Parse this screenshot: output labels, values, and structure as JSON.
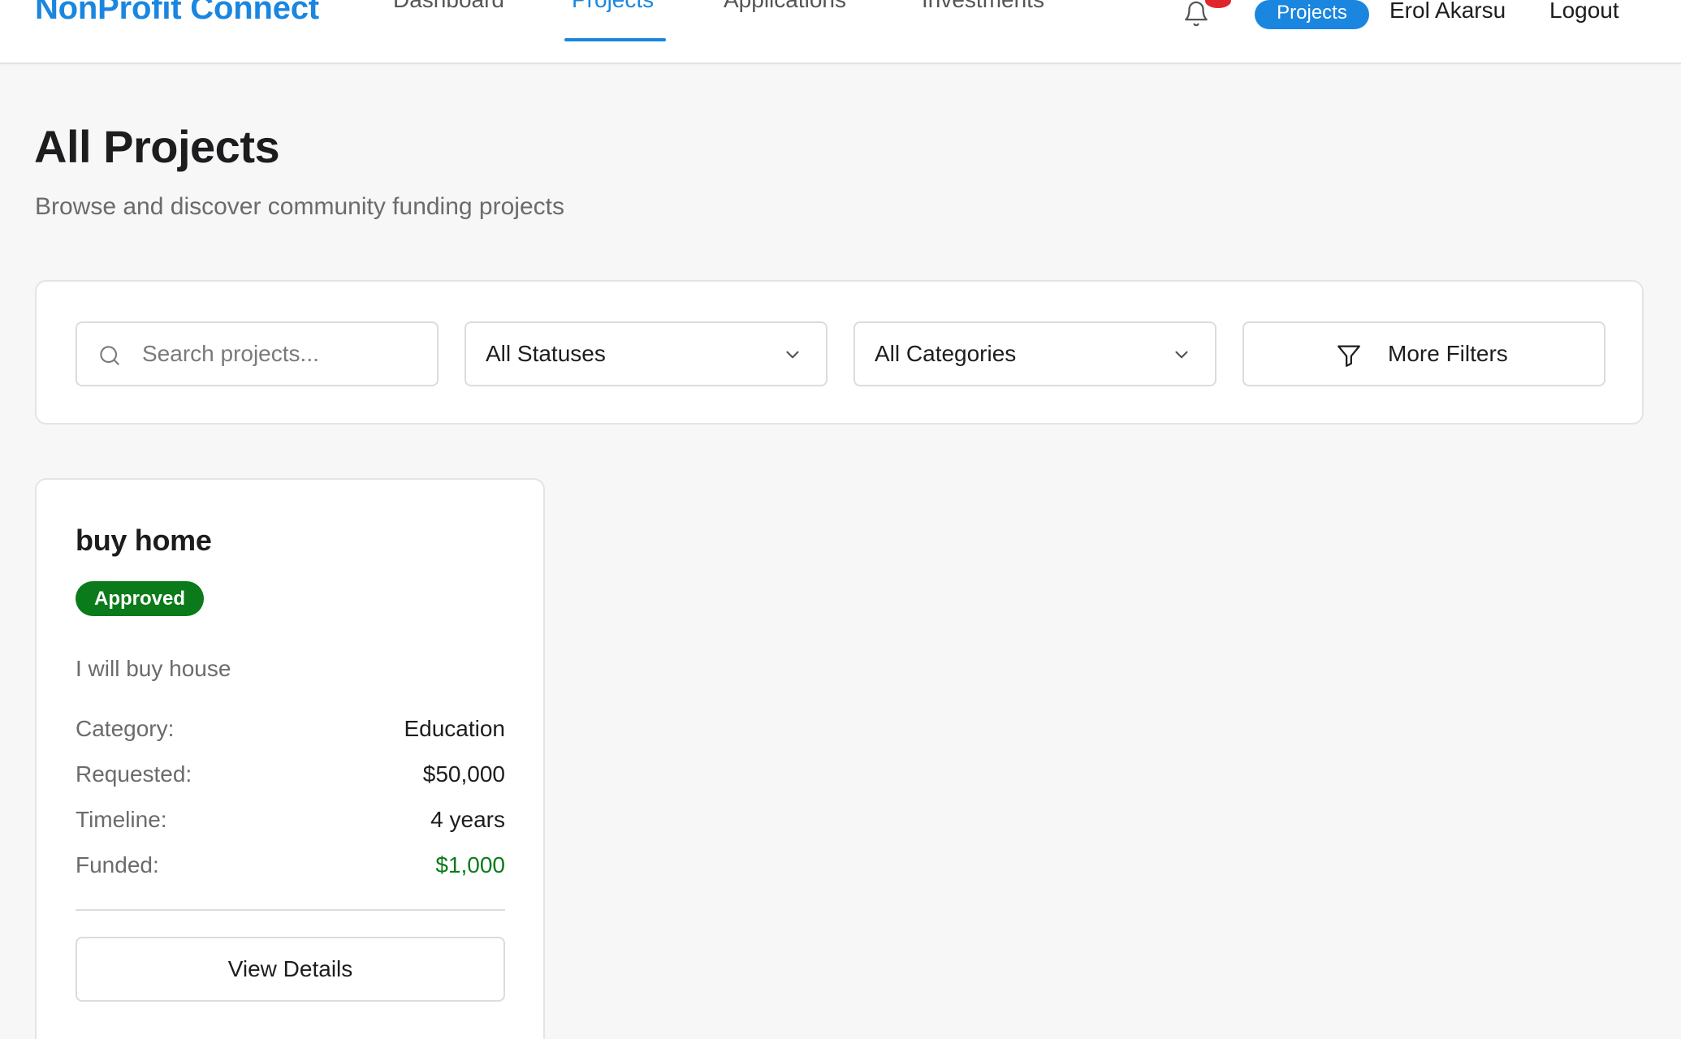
{
  "header": {
    "brand": "NonProfit Connect",
    "nav": [
      {
        "label": "Dashboard",
        "active": false
      },
      {
        "label": "Projects",
        "active": true
      },
      {
        "label": "Applications",
        "active": false
      },
      {
        "label": "Investments",
        "active": false
      }
    ],
    "notification_icon": "bell-icon",
    "role_pill": "Projects",
    "user_name": "Erol Akarsu",
    "logout_label": "Logout"
  },
  "page": {
    "title": "All Projects",
    "subtitle": "Browse and discover community funding projects"
  },
  "filters": {
    "search_placeholder": "Search projects...",
    "status_selected": "All Statuses",
    "category_selected": "All Categories",
    "more_filters_label": "More Filters"
  },
  "projects": [
    {
      "title": "buy home",
      "status": "Approved",
      "description": "I will buy house",
      "details": [
        {
          "label": "Category:",
          "value": "Education"
        },
        {
          "label": "Requested:",
          "value": "$50,000"
        },
        {
          "label": "Timeline:",
          "value": "4 years"
        },
        {
          "label": "Funded:",
          "value": "$1,000"
        }
      ],
      "action_label": "View Details"
    }
  ],
  "colors": {
    "brand": "#1a86e0",
    "approved": "#0a7a1a",
    "funded": "#0a7a1a",
    "notification": "#e0262c",
    "page_background": "#f7f7f7"
  }
}
